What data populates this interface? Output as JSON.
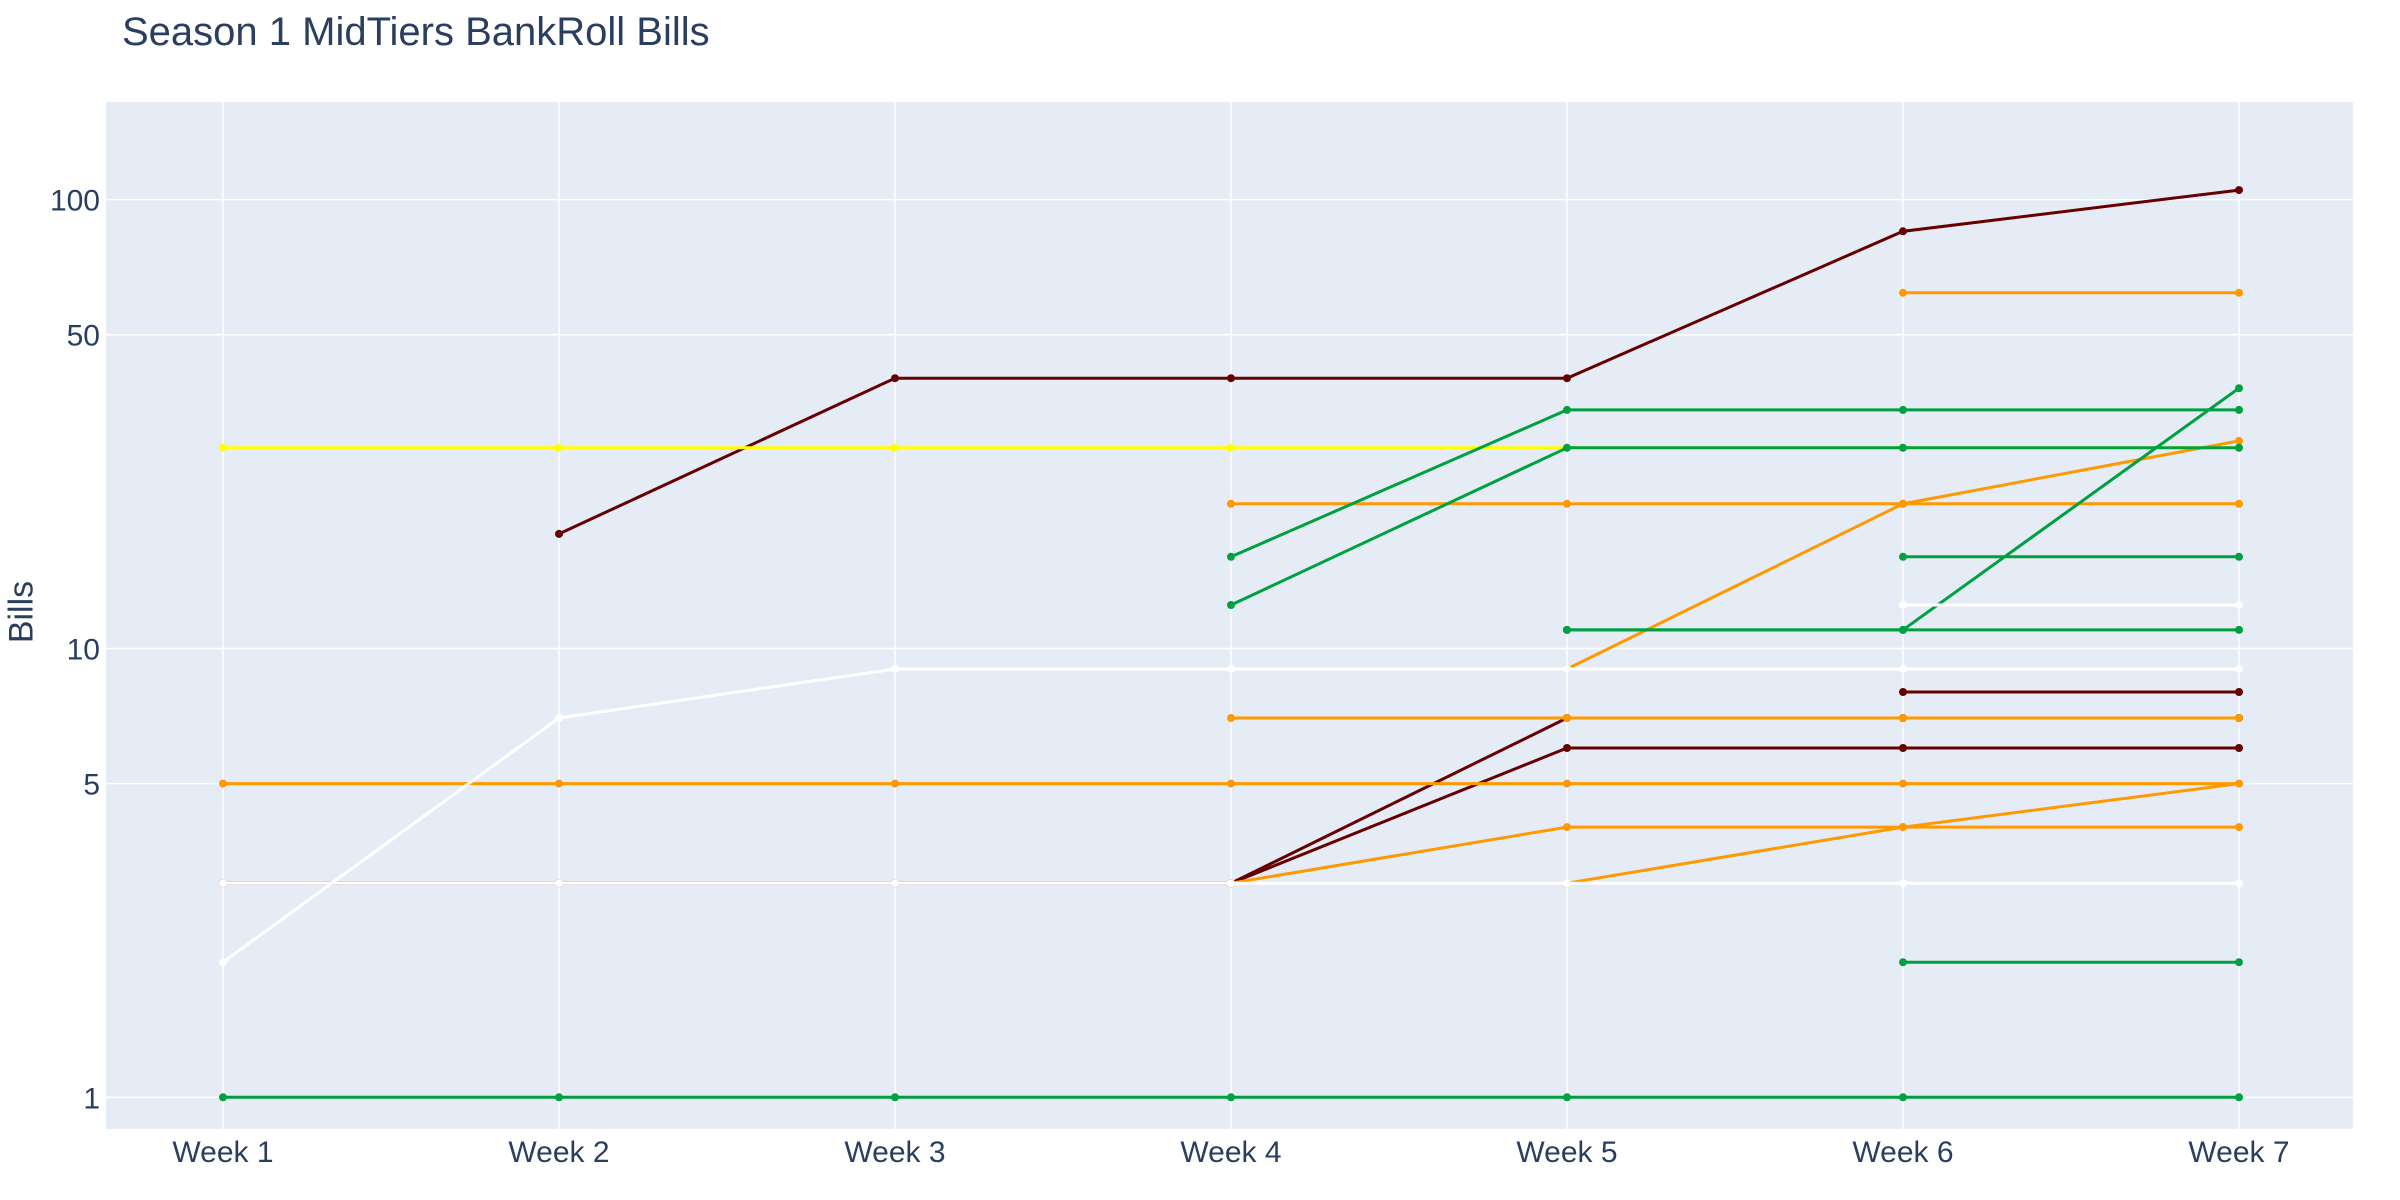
{
  "chart_data": {
    "type": "line",
    "title": "Season 1 MidTiers BankRoll Bills",
    "xlabel": "",
    "ylabel": "Bills",
    "yscale": "log",
    "ylim": [
      0.85,
      165
    ],
    "yticks": [
      1,
      5,
      10,
      50,
      100
    ],
    "ytick_labels": [
      "1",
      "5",
      "10",
      "50",
      "100"
    ],
    "grid": true,
    "legend": "none",
    "plot_background": "#e5ecf6",
    "categories": [
      "Week 1",
      "Week 2",
      "Week 3",
      "Week 4",
      "Week 5",
      "Week 6",
      "Week 7"
    ],
    "series": [
      {
        "color": "#660000",
        "values": [
          null,
          18,
          40,
          40,
          40,
          85,
          105
        ]
      },
      {
        "color": "#660000",
        "values": [
          3,
          3,
          3,
          3,
          7,
          7,
          7
        ]
      },
      {
        "color": "#660000",
        "values": [
          null,
          null,
          null,
          3,
          6,
          6,
          6
        ]
      },
      {
        "color": "#660000",
        "values": [
          null,
          null,
          null,
          null,
          null,
          8,
          8
        ]
      },
      {
        "color": "#ffff00",
        "values": [
          28,
          28,
          28,
          28,
          28,
          28,
          28
        ]
      },
      {
        "color": "#ff9900",
        "values": [
          null,
          null,
          null,
          null,
          null,
          62,
          62
        ]
      },
      {
        "color": "#ff9900",
        "values": [
          null,
          null,
          null,
          21,
          21,
          21,
          21
        ]
      },
      {
        "color": "#ff9900",
        "values": [
          null,
          null,
          null,
          null,
          9,
          21,
          29
        ]
      },
      {
        "color": "#ff9900",
        "values": [
          null,
          null,
          null,
          7,
          7,
          7,
          7
        ]
      },
      {
        "color": "#ff9900",
        "values": [
          5,
          5,
          5,
          5,
          5,
          5,
          5
        ]
      },
      {
        "color": "#ff9900",
        "values": [
          null,
          null,
          null,
          3,
          4,
          4,
          4
        ]
      },
      {
        "color": "#ff9900",
        "values": [
          null,
          null,
          null,
          null,
          3,
          4,
          5
        ]
      },
      {
        "color": "#00a040",
        "values": [
          null,
          null,
          null,
          16,
          34,
          34,
          34
        ]
      },
      {
        "color": "#00a040",
        "values": [
          null,
          null,
          null,
          12.5,
          28,
          28,
          28
        ]
      },
      {
        "color": "#00a040",
        "values": [
          null,
          null,
          null,
          null,
          11,
          11,
          38
        ]
      },
      {
        "color": "#00a040",
        "values": [
          null,
          null,
          null,
          null,
          11,
          11,
          11
        ]
      },
      {
        "color": "#00a040",
        "values": [
          null,
          null,
          null,
          null,
          null,
          16,
          16
        ]
      },
      {
        "color": "#00a040",
        "values": [
          null,
          null,
          null,
          null,
          null,
          2,
          2
        ]
      },
      {
        "color": "#00a040",
        "values": [
          1,
          1,
          1,
          1,
          1,
          1,
          1
        ]
      },
      {
        "color": "#ffffff",
        "values": [
          2,
          7,
          9,
          9,
          9,
          9,
          9
        ]
      },
      {
        "color": "#ffffff",
        "values": [
          null,
          null,
          null,
          null,
          null,
          12.5,
          12.5
        ]
      },
      {
        "color": "#ffffff",
        "values": [
          3,
          3,
          3,
          3,
          3,
          3,
          3
        ]
      }
    ]
  }
}
